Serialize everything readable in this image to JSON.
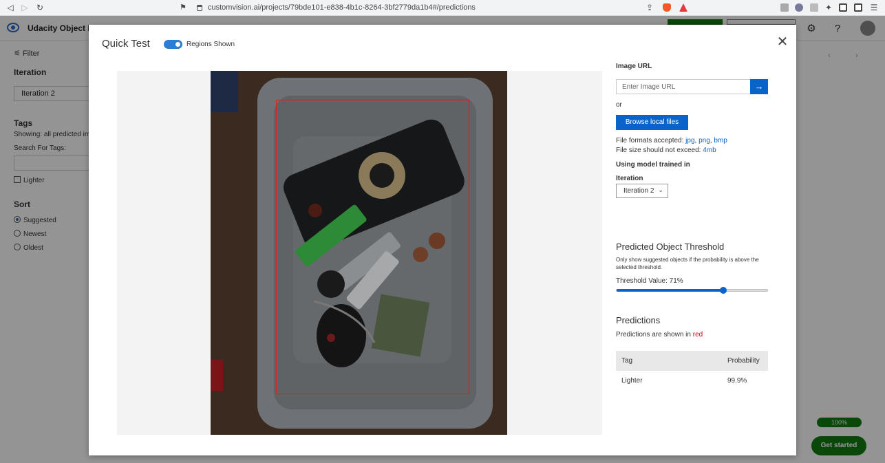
{
  "browser": {
    "url": "customvision.ai/projects/79bde101-e838-4b1c-8264-3bf2779da1b4#/predictions",
    "icons": [
      "back-icon",
      "forward-icon",
      "reload-icon",
      "bookmark-icon",
      "lock-icon",
      "share-icon",
      "brave-shield-icon",
      "brave-rewards-icon",
      "extensions-icon",
      "menu-icon"
    ],
    "badge_counts": [
      "3",
      "2"
    ]
  },
  "app": {
    "name": "Udacity Object Detec",
    "header_icons": [
      "settings-icon",
      "help-icon"
    ]
  },
  "sidebar": {
    "filter_label": "Filter",
    "iteration_heading": "Iteration",
    "iteration_value": "Iteration 2",
    "tags_heading": "Tags",
    "tags_showing": "Showing: all predicted ima",
    "search_tags_label": "Search For Tags:",
    "tag_item": "Lighter",
    "sort_heading": "Sort",
    "sort_options": [
      {
        "label": "Suggested",
        "selected": true
      },
      {
        "label": "Newest",
        "selected": false
      },
      {
        "label": "Oldest",
        "selected": false
      }
    ]
  },
  "background": {
    "progress_label": "100%",
    "progress_value": 1.0,
    "get_started_label": "Get started",
    "pager": {
      "prev": "‹",
      "next": "›"
    }
  },
  "modal": {
    "title": "Quick Test",
    "regions_toggle_label": "Regions Shown",
    "regions_toggle_on": true,
    "image_url_heading": "Image URL",
    "image_url_placeholder": "Enter Image URL",
    "or_text": "or",
    "browse_label": "Browse local files",
    "formats_prefix": "File formats accepted: ",
    "formats": [
      "jpg",
      "png",
      "bmp"
    ],
    "size_prefix": "File size should not exceed: ",
    "size_value": "4mb",
    "model_heading": "Using model trained in",
    "iteration_label": "Iteration",
    "iteration_value": "Iteration 2",
    "threshold_heading": "Predicted Object Threshold",
    "threshold_desc_1": "Only show suggested objects if the probability is above the",
    "threshold_desc_2": "selected threshold.",
    "threshold_label": "Threshold Value: 71%",
    "threshold_value": 0.71,
    "predictions_heading": "Predictions",
    "predictions_desc_prefix": "Predictions are shown in ",
    "predictions_desc_color": "red",
    "table": {
      "headers": [
        "Tag",
        "Probability"
      ],
      "rows": [
        [
          "Lighter",
          "99.9%"
        ]
      ]
    }
  },
  "colors": {
    "accent": "#0a63c9",
    "toggle": "#2a7fd4",
    "prediction_box": "#e02020",
    "success": "#107c10"
  }
}
